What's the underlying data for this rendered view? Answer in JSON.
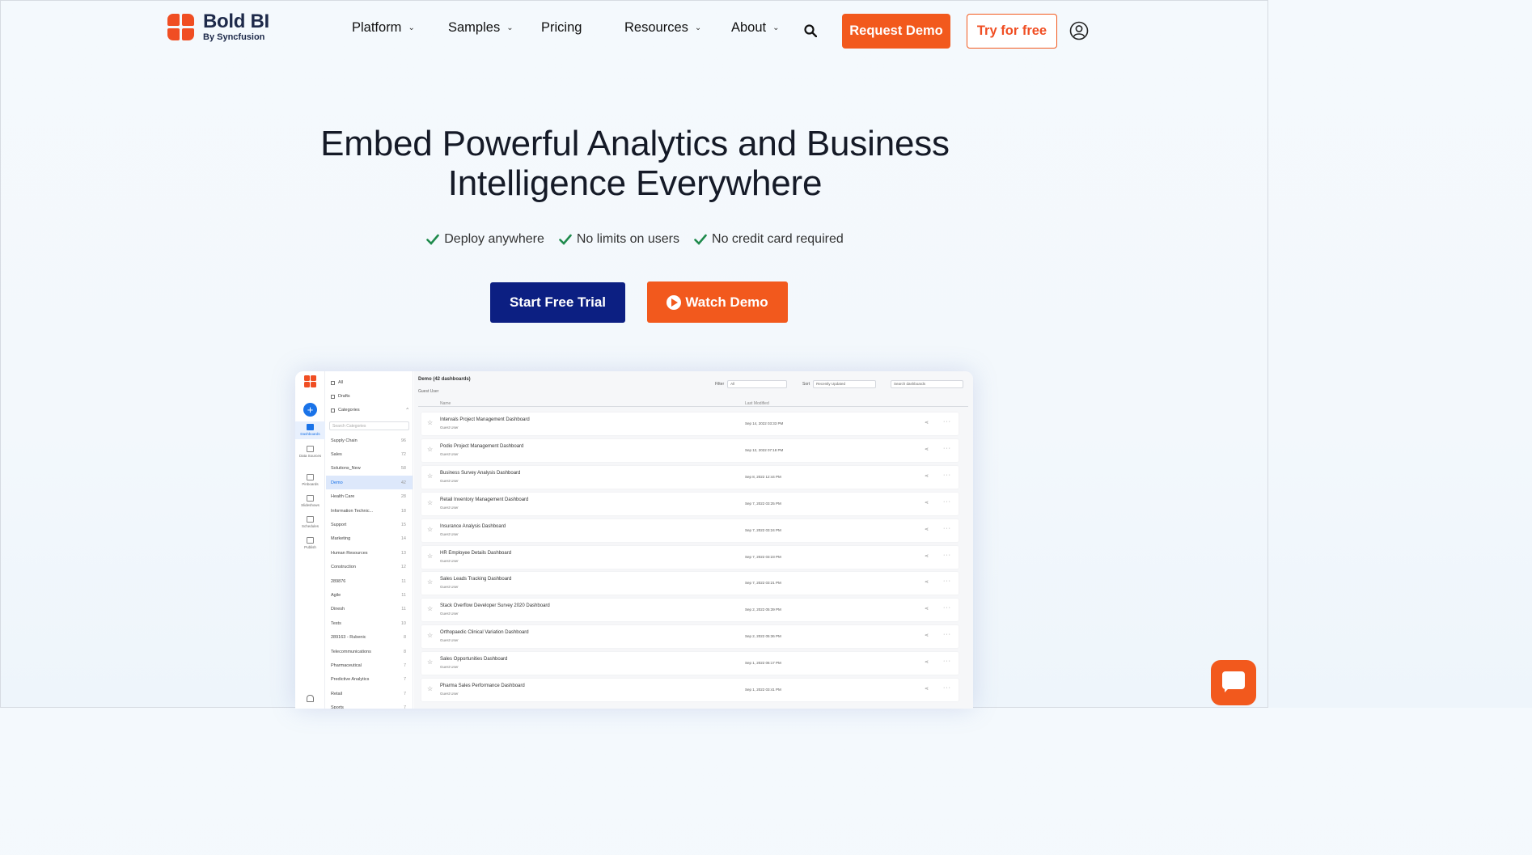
{
  "brand": {
    "name": "Bold BI",
    "sub": "By Syncfusion",
    "accent": "#f2591d",
    "navy": "#0c1f82"
  },
  "nav": {
    "items": [
      {
        "label": "Platform",
        "dropdown": true
      },
      {
        "label": "Samples",
        "dropdown": true
      },
      {
        "label": "Pricing",
        "dropdown": false
      },
      {
        "label": "Resources",
        "dropdown": true
      },
      {
        "label": "About",
        "dropdown": true
      }
    ],
    "search_icon": "search-icon",
    "request_demo": "Request Demo",
    "try_free": "Try for free",
    "user_icon": "user-circle-icon"
  },
  "hero": {
    "title_line1": "Embed Powerful Analytics and Business",
    "title_line2": "Intelligence Everywhere",
    "checks": [
      "Deploy anywhere",
      "No limits on users",
      "No credit card required"
    ],
    "start_trial": "Start Free Trial",
    "watch_demo": "Watch Demo"
  },
  "app": {
    "rail": [
      "Dashboards",
      "Data Sources",
      "Pinboards",
      "Slideshows",
      "Schedules",
      "Publish"
    ],
    "cats_top": [
      "All",
      "Drafts",
      "Categories"
    ],
    "search_placeholder": "Search Categories",
    "categories": [
      {
        "name": "Supply Chain",
        "count": "96"
      },
      {
        "name": "Sales",
        "count": "72"
      },
      {
        "name": "Solutions_New",
        "count": "58"
      },
      {
        "name": "Demo",
        "count": "42",
        "active": true
      },
      {
        "name": "Health Care",
        "count": "28"
      },
      {
        "name": "Information Technic...",
        "count": "18"
      },
      {
        "name": "Support",
        "count": "15"
      },
      {
        "name": "Marketing",
        "count": "14"
      },
      {
        "name": "Human Resources",
        "count": "13"
      },
      {
        "name": "Construction",
        "count": "12"
      },
      {
        "name": "289876",
        "count": "11"
      },
      {
        "name": "Agile",
        "count": "11"
      },
      {
        "name": "Dinesh",
        "count": "11"
      },
      {
        "name": "Tests",
        "count": "10"
      },
      {
        "name": "289163 - Rubenic",
        "count": "8"
      },
      {
        "name": "Telecommunications",
        "count": "8"
      },
      {
        "name": "Pharmaceutical",
        "count": "7"
      },
      {
        "name": "Predictive Analytics",
        "count": "7"
      },
      {
        "name": "Retail",
        "count": "7"
      },
      {
        "name": "Sports",
        "count": "7"
      }
    ],
    "title": "Demo (42 dashboards)",
    "subtitle": "Guest User",
    "filter_label": "Filter",
    "filter_value": "All",
    "sort_label": "Sort",
    "sort_value": "Recently Updated",
    "search_dash": "Search dashboards",
    "col_name": "Name",
    "col_modified": "Last Modified",
    "rows": [
      {
        "name": "Intervals Project Management Dashboard",
        "user": "Guest User",
        "date": "Sep 14, 2022 03:33 PM"
      },
      {
        "name": "Podio Project Management Dashboard",
        "user": "Guest User",
        "date": "Sep 12, 2022 07:18 PM"
      },
      {
        "name": "Business Survey Analysis Dashboard",
        "user": "Guest User",
        "date": "Sep 8, 2022 12:44 PM"
      },
      {
        "name": "Retail Inventory Management Dashboard",
        "user": "Guest User",
        "date": "Sep 7, 2022 03:25 PM"
      },
      {
        "name": "Insurance Analysis Dashboard",
        "user": "Guest User",
        "date": "Sep 7, 2022 03:24 PM"
      },
      {
        "name": "HR Employee Details Dashboard",
        "user": "Guest User",
        "date": "Sep 7, 2022 03:23 PM"
      },
      {
        "name": "Sales Leads Tracking Dashboard",
        "user": "Guest User",
        "date": "Sep 7, 2022 03:21 PM"
      },
      {
        "name": "Stack Overflow Developer Survey 2020 Dashboard",
        "user": "Guest User",
        "date": "Sep 2, 2022 05:39 PM"
      },
      {
        "name": "Orthopaedic Clinical Variation Dashboard",
        "user": "Guest User",
        "date": "Sep 2, 2022 05:36 PM"
      },
      {
        "name": "Sales Opportunities Dashboard",
        "user": "Guest User",
        "date": "Sep 1, 2022 06:17 PM"
      },
      {
        "name": "Pharma Sales Performance Dashboard",
        "user": "Guest User",
        "date": "Sep 1, 2022 03:41 PM"
      }
    ]
  },
  "chat_icon": "chat-bubble-icon"
}
